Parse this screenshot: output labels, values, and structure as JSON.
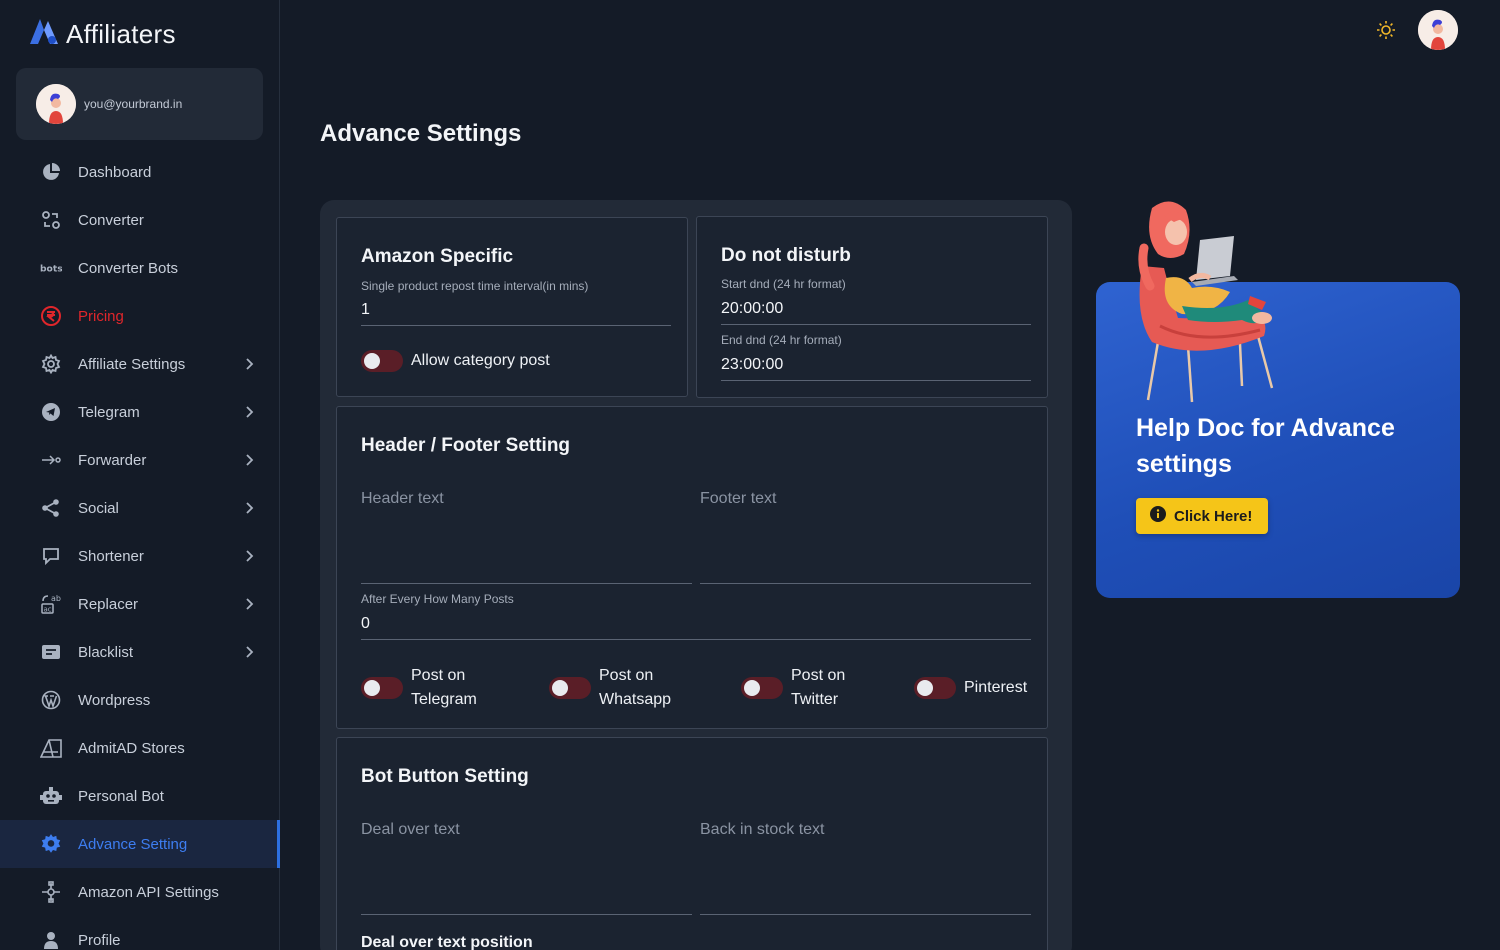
{
  "brand": {
    "name": "Affiliaters",
    "logo_icon": "brand-logo-icon"
  },
  "user": {
    "email": "you@yourbrand.in"
  },
  "sidebar": {
    "items": [
      {
        "label": "Dashboard",
        "icon": "pie-chart-icon"
      },
      {
        "label": "Converter",
        "icon": "converter-icon"
      },
      {
        "label": "Converter Bots",
        "icon": "bots-icon"
      },
      {
        "label": "Pricing",
        "icon": "rupee-icon"
      },
      {
        "label": "Affiliate Settings",
        "icon": "gear-icon"
      },
      {
        "label": "Telegram",
        "icon": "telegram-icon"
      },
      {
        "label": "Forwarder",
        "icon": "forward-icon"
      },
      {
        "label": "Social",
        "icon": "share-icon"
      },
      {
        "label": "Shortener",
        "icon": "shortener-icon"
      },
      {
        "label": "Replacer",
        "icon": "replace-icon"
      },
      {
        "label": "Blacklist",
        "icon": "blacklist-icon"
      },
      {
        "label": "Wordpress",
        "icon": "wordpress-icon"
      },
      {
        "label": "AdmitAD Stores",
        "icon": "admitad-icon"
      },
      {
        "label": "Personal Bot",
        "icon": "robot-icon"
      },
      {
        "label": "Advance Setting",
        "icon": "gear-filled-icon"
      },
      {
        "label": "Amazon API Settings",
        "icon": "api-icon"
      },
      {
        "label": "Profile",
        "icon": "person-icon"
      }
    ],
    "active": "Advance Setting",
    "highlight_color": "#e0262b",
    "active_color": "#3d7df0"
  },
  "page": {
    "title": "Advance Settings"
  },
  "amazon": {
    "title": "Amazon Specific",
    "repost_label": "Single product repost time interval(in mins)",
    "repost_value": "1",
    "allow_category_label": "Allow category post"
  },
  "dnd": {
    "title": "Do not disturb",
    "start_label": "Start dnd (24 hr format)",
    "start_value": "20:00:00",
    "end_label": "End dnd (24 hr format)",
    "end_value": "23:00:00"
  },
  "header_footer": {
    "title": "Header / Footer Setting",
    "header_placeholder": "Header text",
    "footer_placeholder": "Footer text",
    "after_posts_label": "After Every How Many Posts",
    "after_posts_value": "0",
    "toggles": {
      "telegram_line1": "Post on",
      "telegram_line2": "Telegram",
      "whatsapp_line1": "Post on",
      "whatsapp_line2": "Whatsapp",
      "twitter_line1": "Post on",
      "twitter_line2": "Twitter",
      "pinterest": "Pinterest"
    }
  },
  "bot_button": {
    "title": "Bot Button Setting",
    "deal_over_placeholder": "Deal over text",
    "back_in_stock_placeholder": "Back in stock text",
    "position_label": "Deal over text position"
  },
  "help": {
    "title": "Help Doc for Advance settings",
    "button_label": "Click Here!",
    "button_color": "#f5c518"
  },
  "theme_toggle_icon": "sun-icon"
}
